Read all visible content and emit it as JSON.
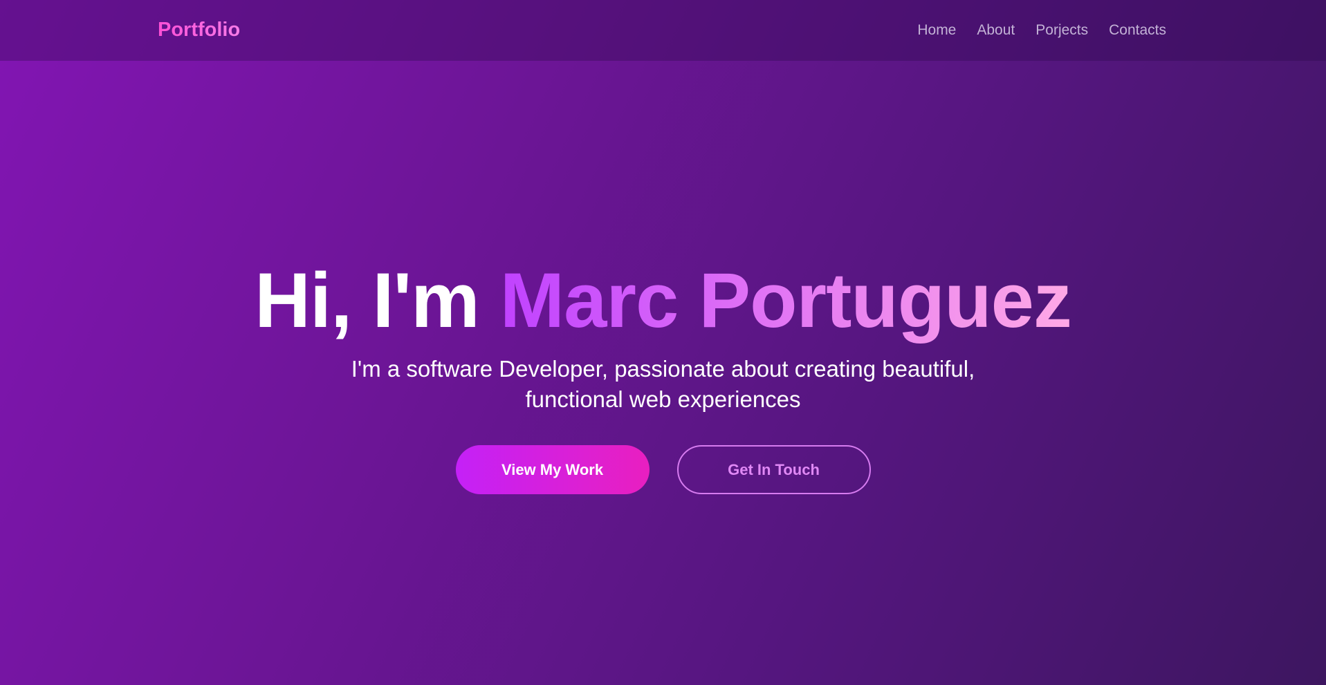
{
  "navbar": {
    "brand": "Portfolio",
    "links": [
      {
        "label": "Home"
      },
      {
        "label": "About"
      },
      {
        "label": "Porjects"
      },
      {
        "label": "Contacts"
      }
    ]
  },
  "hero": {
    "greeting": "Hi, I'm",
    "name": "Marc Portuguez",
    "subtitle_line1": "I'm a software Developer, passionate about creating beautiful,",
    "subtitle_line2": "functional web experiences",
    "primary_cta": "View My Work",
    "secondary_cta": "Get In Touch"
  },
  "colors": {
    "brand_pink": "#ff4fd6",
    "accent_purple": "#c042ff",
    "accent_pink": "#ffa9e6",
    "button_gradient_start": "#c421f7",
    "button_gradient_end": "#e91fc0",
    "nav_link": "#c3b2d6"
  }
}
